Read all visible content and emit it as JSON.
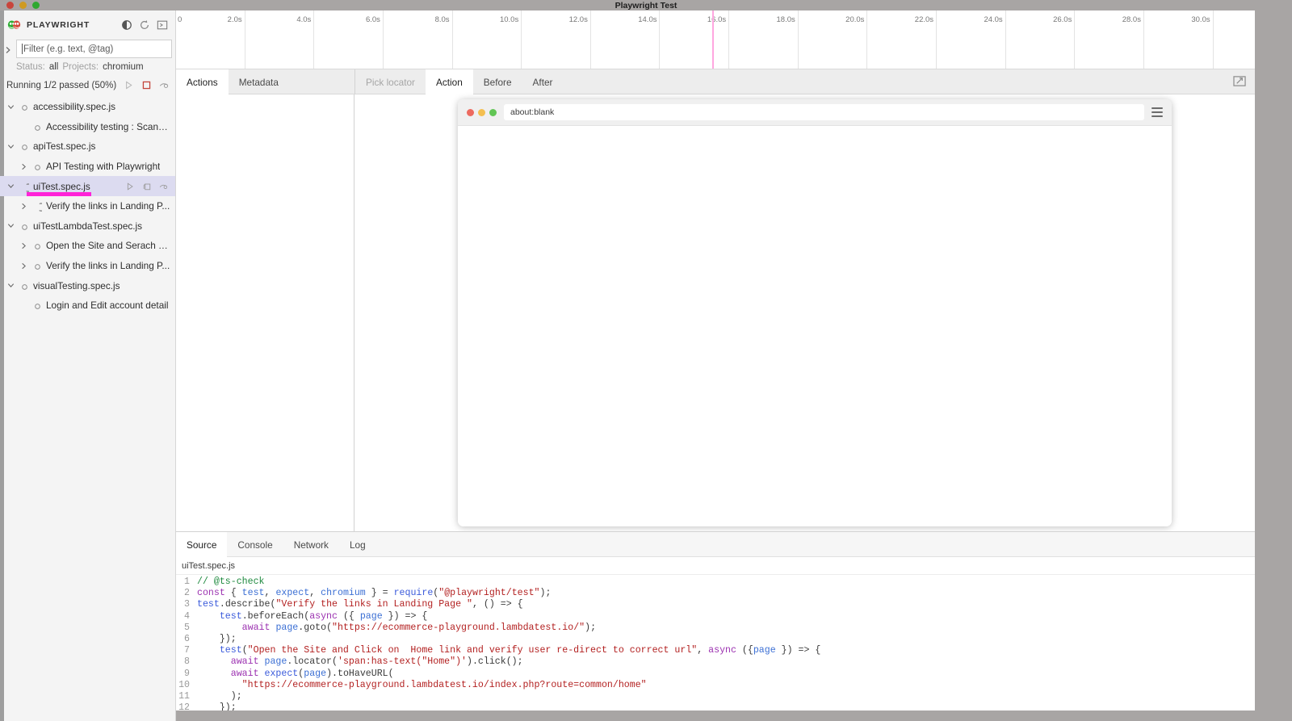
{
  "window": {
    "title": "Playwright Test"
  },
  "sidebar": {
    "brand": "PLAYWRIGHT",
    "header_icons": [
      {
        "name": "theme-toggle-icon",
        "label": "Toggle theme"
      },
      {
        "name": "reload-icon",
        "label": "Reload"
      },
      {
        "name": "console-icon",
        "label": "Toggle output"
      }
    ],
    "filter": {
      "placeholder": "Filter (e.g. text, @tag)",
      "value": ""
    },
    "status": {
      "status_label": "Status:",
      "status_value": "all",
      "projects_label": "Projects:",
      "projects_value": "chromium"
    },
    "run": {
      "text": "Running 1/2 passed (50%)",
      "icons": [
        {
          "name": "run-icon",
          "label": "Run"
        },
        {
          "name": "stop-icon",
          "label": "Stop"
        },
        {
          "name": "watch-icon",
          "label": "Watch"
        }
      ]
    },
    "tree": [
      {
        "label": "accessibility.spec.js",
        "depth": 0,
        "chevron": "down",
        "marker": "circle",
        "selected": false,
        "icons": false
      },
      {
        "label": "Accessibility testing : Scanni...",
        "depth": 1,
        "chevron": "none",
        "marker": "circle",
        "selected": false,
        "icons": false
      },
      {
        "label": "apiTest.spec.js",
        "depth": 0,
        "chevron": "down",
        "marker": "circle",
        "selected": false,
        "icons": false
      },
      {
        "label": "API Testing with Playwright",
        "depth": 1,
        "chevron": "right",
        "marker": "circle",
        "selected": false,
        "icons": false
      },
      {
        "label": "uiTest.spec.js",
        "depth": 0,
        "chevron": "down",
        "marker": "spinner",
        "selected": true,
        "icons": true,
        "progress": true
      },
      {
        "label": "Verify the links in Landing P...",
        "depth": 1,
        "chevron": "right",
        "marker": "spinner",
        "selected": false,
        "icons": false
      },
      {
        "label": "uiTestLambdaTest.spec.js",
        "depth": 0,
        "chevron": "down",
        "marker": "circle",
        "selected": false,
        "icons": false
      },
      {
        "label": "Open the Site and Serach th...",
        "depth": 1,
        "chevron": "right",
        "marker": "circle",
        "selected": false,
        "icons": false
      },
      {
        "label": "Verify the links in Landing P...",
        "depth": 1,
        "chevron": "right",
        "marker": "circle",
        "selected": false,
        "icons": false
      },
      {
        "label": "visualTesting.spec.js",
        "depth": 0,
        "chevron": "down",
        "marker": "circle",
        "selected": false,
        "icons": false
      },
      {
        "label": "Login and Edit account detail",
        "depth": 1,
        "chevron": "none",
        "marker": "circle",
        "selected": false,
        "icons": false
      }
    ],
    "row_icons": [
      {
        "name": "run-row-icon",
        "label": "Run"
      },
      {
        "name": "copy-row-icon",
        "label": "Copy"
      },
      {
        "name": "watch-row-icon",
        "label": "Watch"
      }
    ]
  },
  "timeline": {
    "zero_label": "0",
    "ticks": [
      "2.0s",
      "4.0s",
      "6.0s",
      "8.0s",
      "10.0s",
      "12.0s",
      "14.0s",
      "16.0s",
      "18.0s",
      "20.0s",
      "22.0s",
      "24.0s",
      "26.0s",
      "28.0s",
      "30.0s"
    ],
    "marker_time": "15.5s",
    "marker_color": "#ffa7e0"
  },
  "tabs": {
    "left": [
      {
        "label": "Actions",
        "active": true
      },
      {
        "label": "Metadata",
        "active": false
      }
    ],
    "right": [
      {
        "label": "Pick locator",
        "active": false,
        "muted": true
      },
      {
        "label": "Action",
        "active": true,
        "muted": false
      },
      {
        "label": "Before",
        "active": false,
        "muted": false
      },
      {
        "label": "After",
        "active": false,
        "muted": false
      }
    ],
    "popout_icon": "popout-icon"
  },
  "browser_mock": {
    "url": "about:blank",
    "menu_icon": "hamburger-menu-icon",
    "lights": [
      "red",
      "yellow",
      "green"
    ]
  },
  "dock": {
    "tabs": [
      {
        "label": "Source",
        "active": true
      },
      {
        "label": "Console",
        "active": false
      },
      {
        "label": "Network",
        "active": false
      },
      {
        "label": "Log",
        "active": false
      }
    ],
    "filename": "uiTest.spec.js",
    "code_lines": [
      {
        "n": "1",
        "tokens": [
          {
            "t": "// @ts-check",
            "c": "cmt"
          }
        ]
      },
      {
        "n": "2",
        "tokens": [
          {
            "t": "const",
            "c": "kw"
          },
          {
            "t": " { ",
            "c": "pun"
          },
          {
            "t": "test",
            "c": "var"
          },
          {
            "t": ", ",
            "c": "pun"
          },
          {
            "t": "expect",
            "c": "var"
          },
          {
            "t": ", ",
            "c": "pun"
          },
          {
            "t": "chromium",
            "c": "var"
          },
          {
            "t": " } = ",
            "c": "pun"
          },
          {
            "t": "require",
            "c": "fn"
          },
          {
            "t": "(",
            "c": "pun"
          },
          {
            "t": "\"@playwright/test\"",
            "c": "str"
          },
          {
            "t": ");",
            "c": "pun"
          }
        ]
      },
      {
        "n": "3",
        "tokens": [
          {
            "t": "test",
            "c": "fn"
          },
          {
            "t": ".",
            "c": "pun"
          },
          {
            "t": "describe",
            "c": "pun"
          },
          {
            "t": "(",
            "c": "pun"
          },
          {
            "t": "\"Verify the links in Landing Page \"",
            "c": "str"
          },
          {
            "t": ", () => {",
            "c": "pun"
          }
        ]
      },
      {
        "n": "4",
        "tokens": [
          {
            "t": "    ",
            "c": "pun"
          },
          {
            "t": "test",
            "c": "fn"
          },
          {
            "t": ".beforeEach(",
            "c": "pun"
          },
          {
            "t": "async",
            "c": "kw"
          },
          {
            "t": " ({ ",
            "c": "pun"
          },
          {
            "t": "page",
            "c": "var"
          },
          {
            "t": " }) => {",
            "c": "pun"
          }
        ]
      },
      {
        "n": "5",
        "tokens": [
          {
            "t": "        ",
            "c": "pun"
          },
          {
            "t": "await",
            "c": "kw"
          },
          {
            "t": " ",
            "c": "pun"
          },
          {
            "t": "page",
            "c": "var"
          },
          {
            "t": ".goto(",
            "c": "pun"
          },
          {
            "t": "\"https://ecommerce-playground.lambdatest.io/\"",
            "c": "str"
          },
          {
            "t": ");",
            "c": "pun"
          }
        ]
      },
      {
        "n": "6",
        "tokens": [
          {
            "t": "    });",
            "c": "pun"
          }
        ]
      },
      {
        "n": "7",
        "tokens": [
          {
            "t": "    ",
            "c": "pun"
          },
          {
            "t": "test",
            "c": "fn"
          },
          {
            "t": "(",
            "c": "pun"
          },
          {
            "t": "\"Open the Site and Click on  Home link and verify user re-direct to correct url\"",
            "c": "str"
          },
          {
            "t": ", ",
            "c": "pun"
          },
          {
            "t": "async",
            "c": "kw"
          },
          {
            "t": " ({",
            "c": "pun"
          },
          {
            "t": "page",
            "c": "var"
          },
          {
            "t": " }) => {",
            "c": "pun"
          }
        ]
      },
      {
        "n": "8",
        "tokens": [
          {
            "t": "      ",
            "c": "pun"
          },
          {
            "t": "await",
            "c": "kw"
          },
          {
            "t": " ",
            "c": "pun"
          },
          {
            "t": "page",
            "c": "var"
          },
          {
            "t": ".locator(",
            "c": "pun"
          },
          {
            "t": "'span:has-text(\"Home\")'",
            "c": "str"
          },
          {
            "t": ").click();",
            "c": "pun"
          }
        ]
      },
      {
        "n": "9",
        "tokens": [
          {
            "t": "      ",
            "c": "pun"
          },
          {
            "t": "await",
            "c": "kw"
          },
          {
            "t": " ",
            "c": "pun"
          },
          {
            "t": "expect",
            "c": "fn"
          },
          {
            "t": "(",
            "c": "pun"
          },
          {
            "t": "page",
            "c": "var"
          },
          {
            "t": ").toHaveURL(",
            "c": "pun"
          }
        ]
      },
      {
        "n": "10",
        "tokens": [
          {
            "t": "        ",
            "c": "pun"
          },
          {
            "t": "\"https://ecommerce-playground.lambdatest.io/index.php?route=common/home\"",
            "c": "str"
          }
        ]
      },
      {
        "n": "11",
        "tokens": [
          {
            "t": "      );",
            "c": "pun"
          }
        ]
      },
      {
        "n": "12",
        "tokens": [
          {
            "t": "    });",
            "c": "pun"
          }
        ]
      }
    ]
  },
  "colors": {
    "accent_progress": "#ff22d8",
    "selection": "#dcdbf0",
    "titlebar": "#a8a5a4",
    "sidebar_bg": "#f4f4f4",
    "stop_red": "#c4453c"
  }
}
